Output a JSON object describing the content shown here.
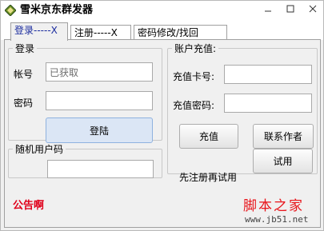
{
  "window": {
    "title": "雪米京东群发器",
    "icons": {
      "app": "diamond-app-icon",
      "minimize": "minimize-icon",
      "maximize": "maximize-icon",
      "close": "close-icon"
    }
  },
  "tabs": [
    {
      "label": "登录-----X",
      "active": true
    },
    {
      "label": "注册-----X",
      "active": false
    },
    {
      "label": "密码修改/找回",
      "active": false
    }
  ],
  "login": {
    "group_title": "登录",
    "account_label": "帐号",
    "account_value": "已获取",
    "password_label": "密码",
    "password_value": "",
    "login_button": "登陆"
  },
  "random_user": {
    "group_title": "随机用户码",
    "value": ""
  },
  "recharge": {
    "group_title": "账户充值:",
    "card_label": "充值卡号:",
    "card_value": "",
    "password_label": "充值密码:",
    "password_value": "",
    "recharge_button": "充值",
    "contact_button": "联系作者",
    "trial_hint": "先注册再试用",
    "trial_button": "试用"
  },
  "notice": "公告啊",
  "watermark": {
    "text": "脚本之家",
    "url": "www.jb51.net"
  },
  "colors": {
    "notice": "#e0001b",
    "active_tab_text": "#1a2b9e",
    "primary_button": "#dbe6f5"
  }
}
